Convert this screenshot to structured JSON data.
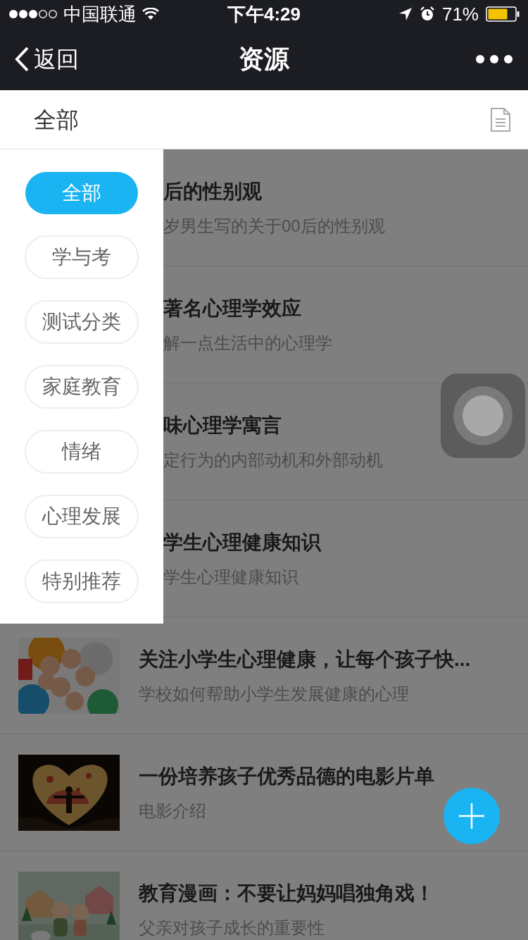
{
  "status_bar": {
    "carrier": "中国联通",
    "time": "下午4:29",
    "battery": "71%"
  },
  "nav": {
    "back": "返回",
    "title": "资源"
  },
  "filter": {
    "label": "全部"
  },
  "categories": [
    {
      "label": "全部",
      "selected": true
    },
    {
      "label": "学与考",
      "selected": false
    },
    {
      "label": "测试分类",
      "selected": false
    },
    {
      "label": "家庭教育",
      "selected": false
    },
    {
      "label": "情绪",
      "selected": false
    },
    {
      "label": "心理发展",
      "selected": false
    },
    {
      "label": "特别推荐",
      "selected": false
    }
  ],
  "articles": [
    {
      "kind": "covered",
      "title": "后的性别观",
      "subtitle": "岁男生写的关于00后的性别观"
    },
    {
      "kind": "covered",
      "title": "著名心理学效应",
      "subtitle": "解一点生活中的心理学"
    },
    {
      "kind": "covered",
      "title": "味心理学寓言",
      "subtitle": "定行为的内部动机和外部动机"
    },
    {
      "kind": "covered",
      "title": "学生心理健康知识",
      "subtitle": "学生心理健康知识"
    },
    {
      "kind": "picture",
      "title": "关注小学生心理健康，让每个孩子快...",
      "subtitle": "学校如何帮助小学生发展健康的心理"
    },
    {
      "kind": "picture",
      "title": "一份培养孩子优秀品德的电影片单",
      "subtitle": "电影介绍"
    },
    {
      "kind": "picture",
      "title": "教育漫画：不要让妈妈唱独角戏！",
      "subtitle": "父亲对孩子成长的重要性"
    }
  ]
}
